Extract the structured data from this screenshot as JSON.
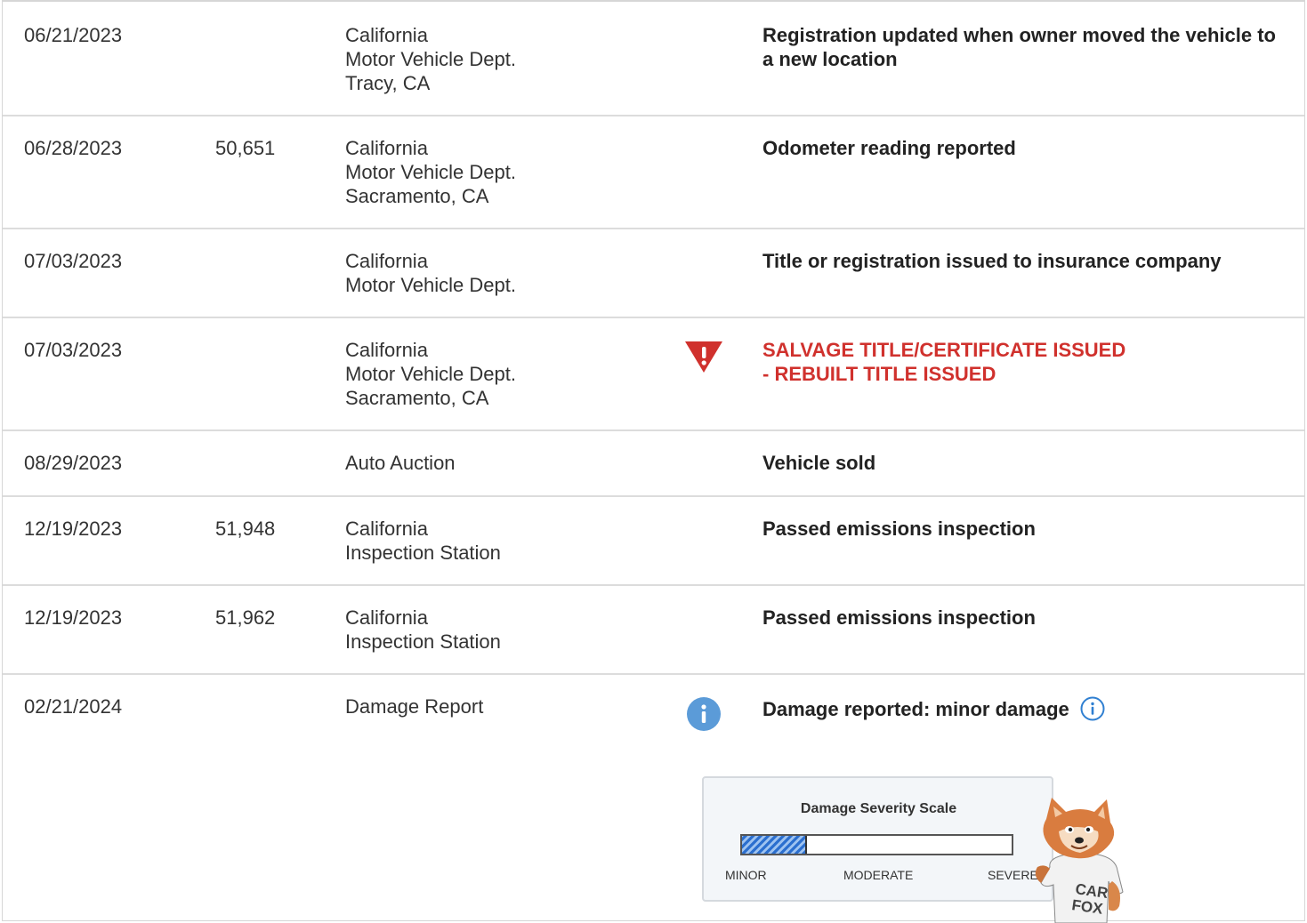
{
  "rows": [
    {
      "date": "06/21/2023",
      "odometer": "",
      "source": [
        "California",
        "Motor Vehicle Dept.",
        "Tracy, CA"
      ],
      "description": "Registration updated when owner moved the vehicle to a new location"
    },
    {
      "date": "06/28/2023",
      "odometer": "50,651",
      "source": [
        "California",
        "Motor Vehicle Dept.",
        "Sacramento, CA"
      ],
      "description": "Odometer reading reported"
    },
    {
      "date": "07/03/2023",
      "odometer": "",
      "source": [
        "California",
        "Motor Vehicle Dept."
      ],
      "description": "Title or registration issued to insurance company"
    },
    {
      "date": "07/03/2023",
      "odometer": "",
      "source": [
        "California",
        "Motor Vehicle Dept.",
        "Sacramento, CA"
      ],
      "description_line1": "SALVAGE TITLE/CERTIFICATE ISSUED",
      "description_line2": "- REBUILT TITLE ISSUED",
      "icon": "alert-triangle-icon"
    },
    {
      "date": "08/29/2023",
      "odometer": "",
      "source": [
        "Auto Auction"
      ],
      "description": "Vehicle sold"
    },
    {
      "date": "12/19/2023",
      "odometer": "51,948",
      "source": [
        "California",
        "Inspection Station"
      ],
      "description": "Passed emissions inspection"
    },
    {
      "date": "12/19/2023",
      "odometer": "51,962",
      "source": [
        "California",
        "Inspection Station"
      ],
      "description": "Passed emissions inspection"
    },
    {
      "date": "02/21/2024",
      "odometer": "",
      "source": [
        "Damage Report"
      ],
      "description": "Damage reported: minor damage",
      "icon": "info-circle-icon"
    }
  ],
  "damage_scale": {
    "title": "Damage Severity Scale",
    "labels": [
      "MINOR",
      "MODERATE",
      "SEVERE"
    ],
    "level_fraction": 0.24
  },
  "mascot_text": "CAR FOX",
  "colors": {
    "alert_red": "#d0312d",
    "info_blue": "#2f7fd1",
    "border": "#dcdcdc"
  }
}
